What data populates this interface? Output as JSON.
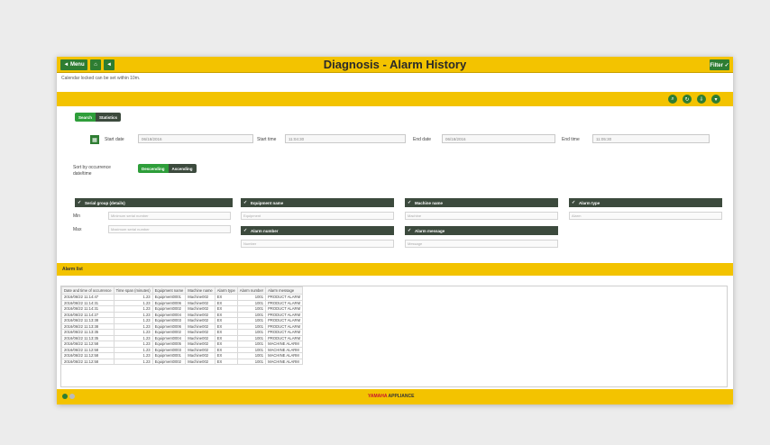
{
  "titlebar": {
    "title": "Diagnosis - Alarm History",
    "menu_label": "◄ Menu",
    "filter_label": "Filter ✓"
  },
  "notice": "Calendar locked can be set within 10m.",
  "tabs": {
    "search": "Search",
    "statistics": "Statistics"
  },
  "date": {
    "start_date_label": "Start date",
    "start_date": "06/18/2016",
    "start_time_label": "Start time",
    "start_time": "11:04:30",
    "end_date_label": "End date",
    "end_date": "06/18/2016",
    "end_time_label": "End time",
    "end_time": "11:05:30"
  },
  "sort": {
    "label": "Sort by occurrence date/time",
    "desc": "Descending",
    "asc": "Ascending"
  },
  "filters": {
    "serial": {
      "header": "Serial group (details)",
      "min_label": "Min",
      "max_label": "Max",
      "min_ph": "Minimum serial number",
      "max_ph": "Maximum serial number"
    },
    "equipment": {
      "header": "Equipment name",
      "ph": "Equipment"
    },
    "alarm_number": {
      "header": "Alarm number",
      "ph": "Number"
    },
    "machine": {
      "header": "Machine name",
      "ph": "Machine"
    },
    "alarm_message": {
      "header": "Alarm message",
      "ph": "Message"
    },
    "alarm_type": {
      "header": "Alarm type",
      "ph": "Alarm"
    }
  },
  "list": {
    "title": "Alarm list",
    "columns": [
      "Date and time of occurrence",
      "Time span (minutes)",
      "Equipment name",
      "Machine name",
      "Alarm type",
      "Alarm number",
      "Alarm message"
    ],
    "rows": [
      [
        "2016/06/22 11:14:47",
        "1.23",
        "Equipment0001",
        "Machine002",
        "EX",
        "1001",
        "PRODUCT ALARM"
      ],
      [
        "2016/06/22 11:14:31",
        "1.23",
        "Equipment0006",
        "Machine002",
        "EX",
        "1001",
        "PRODUCT ALARM"
      ],
      [
        "2016/06/22 11:14:31",
        "1.23",
        "Equipment0002",
        "Machine002",
        "EX",
        "1001",
        "PRODUCT ALARM"
      ],
      [
        "2016/06/22 11:14:27",
        "1.23",
        "Equipment0004",
        "Machine002",
        "EX",
        "1001",
        "PRODUCT ALARM"
      ],
      [
        "2016/06/22 11:13:38",
        "1.23",
        "Equipment0003",
        "Machine002",
        "EX",
        "1001",
        "PRODUCT ALARM"
      ],
      [
        "2016/06/22 11:13:38",
        "1.23",
        "Equipment0006",
        "Machine002",
        "EX",
        "1001",
        "PRODUCT ALARM"
      ],
      [
        "2016/06/22 11:13:35",
        "1.23",
        "Equipment0002",
        "Machine002",
        "EX",
        "1001",
        "PRODUCT ALARM"
      ],
      [
        "2016/06/22 11:13:35",
        "1.23",
        "Equipment0004",
        "Machine002",
        "EX",
        "1001",
        "PRODUCT ALARM"
      ],
      [
        "2016/06/22 11:12:58",
        "1.23",
        "Equipment0005",
        "Machine002",
        "EX",
        "1001",
        "MACHINE ALARM"
      ],
      [
        "2016/06/22 11:12:58",
        "1.23",
        "Equipment0003",
        "Machine002",
        "EX",
        "1001",
        "MACHINE ALARM"
      ],
      [
        "2016/06/22 11:12:58",
        "1.23",
        "Equipment0001",
        "Machine002",
        "EX",
        "1001",
        "MACHINE ALARM"
      ],
      [
        "2016/06/22 11:12:58",
        "1.23",
        "Equipment0002",
        "Machine002",
        "EX",
        "1001",
        "MACHINE ALARM"
      ]
    ]
  },
  "footer": {
    "brand_red": "YAMAHA",
    "brand_dark": "APPLIANCE"
  },
  "colors": {
    "yellow": "#f3c300",
    "green": "#2e7d32",
    "dark": "#3c4a3d"
  }
}
